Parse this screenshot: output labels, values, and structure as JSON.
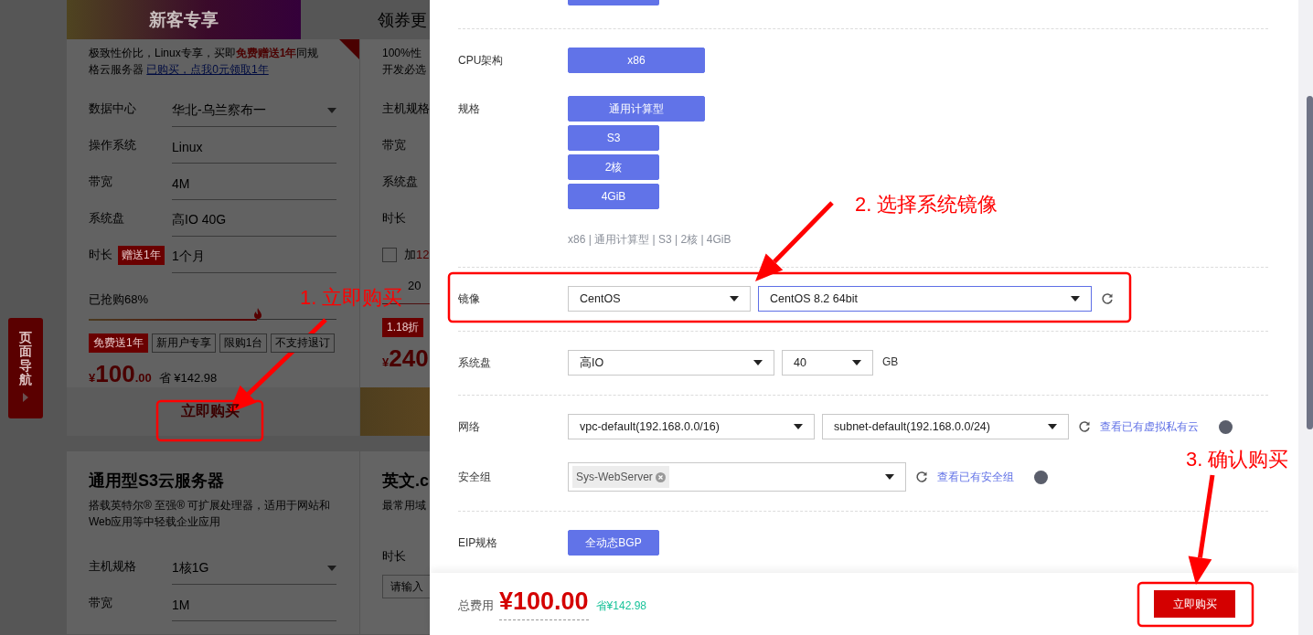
{
  "background_page": {
    "top_tabs": [
      {
        "label": "新客专享",
        "selected": true
      },
      {
        "label": "领券更",
        "selected": false
      }
    ],
    "side_nav": "页面导航",
    "featured_card": {
      "description": "极致性价比，Linux专享，买即**免费赠送1年**同规格云服务器",
      "link": "已购买，点我0元领取1年",
      "fields": [
        {
          "label": "数据中心",
          "value": "华北-乌兰察布一",
          "kind": "dropdown"
        },
        {
          "label": "操作系统",
          "value": "Linux",
          "kind": "text"
        },
        {
          "label": "带宽",
          "value": "4M",
          "kind": "text"
        },
        {
          "label": "系统盘",
          "value": "高IO 40G",
          "kind": "text"
        },
        {
          "label": "时长",
          "badge": "赠送1年",
          "value": "1个月",
          "kind": "text"
        }
      ],
      "progress": {
        "label": "已抢购68%",
        "level": 0.68
      },
      "tags": [
        {
          "label": "免费送1年",
          "kind": "solid"
        },
        {
          "label": "新用户专享",
          "kind": "outline"
        },
        {
          "label": "限购1台",
          "kind": "outline"
        },
        {
          "label": "不支持退订",
          "kind": "outline"
        }
      ],
      "price": {
        "symbol": "¥",
        "integer": "100",
        "decimal": ".00"
      },
      "saving": "省 ¥142.98",
      "buy_button": "立即购买"
    },
    "coupon_card": {
      "description_lines": [
        "100%性",
        "开发必选"
      ],
      "field_labels": [
        "主机规格",
        "带宽",
        "系统盘",
        "时长"
      ],
      "checkbox": {
        "checked": false,
        "prefix": "加",
        "highlight": "12"
      },
      "progress_label": "20",
      "tags": [
        {
          "label": "1.18折",
          "kind": "solid"
        }
      ],
      "price": {
        "symbol": "¥",
        "integer": "240"
      }
    },
    "s3_card": {
      "title": "通用型S3云服务器",
      "description": "搭载英特尔® 至强® 可扩展处理器，适用于网站和Web应用等中轻载企业应用",
      "fields": [
        {
          "label": "主机规格",
          "value": "1核1G",
          "kind": "dropdown"
        },
        {
          "label": "带宽",
          "value": "1M",
          "kind": "text"
        }
      ]
    },
    "domain_card": {
      "title": "英文.c",
      "description": "最常用域",
      "field_label": "时长",
      "placeholder": "请输入"
    }
  },
  "order_drawer": {
    "sections": [
      {
        "rows": [
          {
            "label": "CPU架构",
            "kind": "options",
            "options": [
              {
                "label": "x86",
                "selected": true
              }
            ]
          },
          {
            "label": "规格",
            "kind": "options",
            "options": [
              {
                "label": "通用计算型",
                "selected": true
              },
              {
                "label": "S3",
                "selected": true
              },
              {
                "label": "2核",
                "selected": true
              },
              {
                "label": "4GiB",
                "selected": true
              }
            ],
            "summary": "x86 | 通用计算型 | S3 | 2核 | 4GiB"
          }
        ]
      },
      {
        "rows": [
          {
            "label": "镜像",
            "kind": "selects",
            "selects": [
              {
                "value": "CentOS",
                "focused": false
              },
              {
                "value": "CentOS 8.2 64bit",
                "focused": true
              }
            ],
            "refresh": true
          }
        ]
      },
      {
        "rows": [
          {
            "label": "系统盘",
            "kind": "selects",
            "selects": [
              {
                "value": "高IO",
                "focused": false
              },
              {
                "value": "40",
                "focused": false
              }
            ],
            "unit": "GB",
            "refresh": false
          }
        ]
      },
      {
        "rows": [
          {
            "label": "网络",
            "kind": "selects",
            "selects": [
              {
                "value": "vpc-default(192.168.0.0/16)",
                "focused": false
              },
              {
                "value": "subnet-default(192.168.0.0/24)",
                "focused": false
              }
            ],
            "refresh": true,
            "link": "查看已有虚拟私有云",
            "help": true
          },
          {
            "label": "安全组",
            "kind": "multiselect",
            "tags": [
              "Sys-WebServer"
            ],
            "refresh": true,
            "link": "查看已有安全组",
            "help": true
          }
        ]
      },
      {
        "rows": [
          {
            "label": "EIP规格",
            "kind": "options",
            "options": [
              {
                "label": "全动态BGP",
                "selected": true
              }
            ]
          }
        ]
      }
    ],
    "footer": {
      "total_label": "总费用",
      "total": "¥100.00",
      "saving": "省¥142.98",
      "buy_button": "立即购买"
    }
  },
  "annotations": [
    {
      "text": "1. 立即购买"
    },
    {
      "text": "2. 选择系统镜像"
    },
    {
      "text": "3. 确认购买"
    }
  ]
}
